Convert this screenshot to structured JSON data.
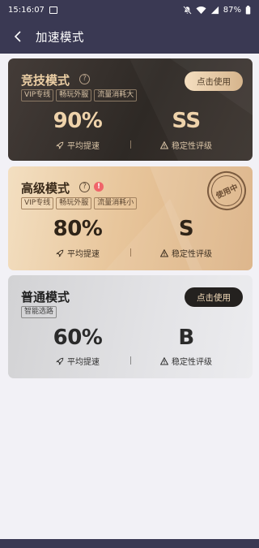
{
  "status_bar": {
    "time": "15:16:07",
    "battery": "87%"
  },
  "navbar": {
    "title": "加速模式"
  },
  "modes": [
    {
      "name": "竞技模式",
      "tags": [
        "VIP专线",
        "畅玩外服",
        "流量消耗大"
      ],
      "speedup": "90%",
      "speedup_label": "平均提速",
      "rating": "SS",
      "rating_label": "稳定性评级",
      "button": "点击使用"
    },
    {
      "name": "高级模式",
      "alert": "!",
      "tags": [
        "VIP专线",
        "畅玩外服",
        "流量消耗小"
      ],
      "speedup": "80%",
      "speedup_label": "平均提速",
      "rating": "S",
      "rating_label": "稳定性评级",
      "stamp": "使用中"
    },
    {
      "name": "普通模式",
      "tags": [
        "智能选路"
      ],
      "speedup": "60%",
      "speedup_label": "平均提速",
      "rating": "B",
      "rating_label": "稳定性评级",
      "button": "点击使用"
    }
  ],
  "help_glyph": "?",
  "colors": {
    "header_bg": "#3a3953",
    "page_bg": "#f2f1f6",
    "gold_text": "#eccfa5",
    "alert_red": "#f0646a"
  },
  "icons": {
    "back": "chevron-left-icon",
    "image_notification": "image-icon",
    "mute": "mute-bell-icon",
    "wifi": "wifi-icon",
    "signal": "signal-icon",
    "battery": "battery-icon",
    "help": "question-circle-icon",
    "rocket": "rocket-icon",
    "stability": "warning-triangle-icon"
  }
}
